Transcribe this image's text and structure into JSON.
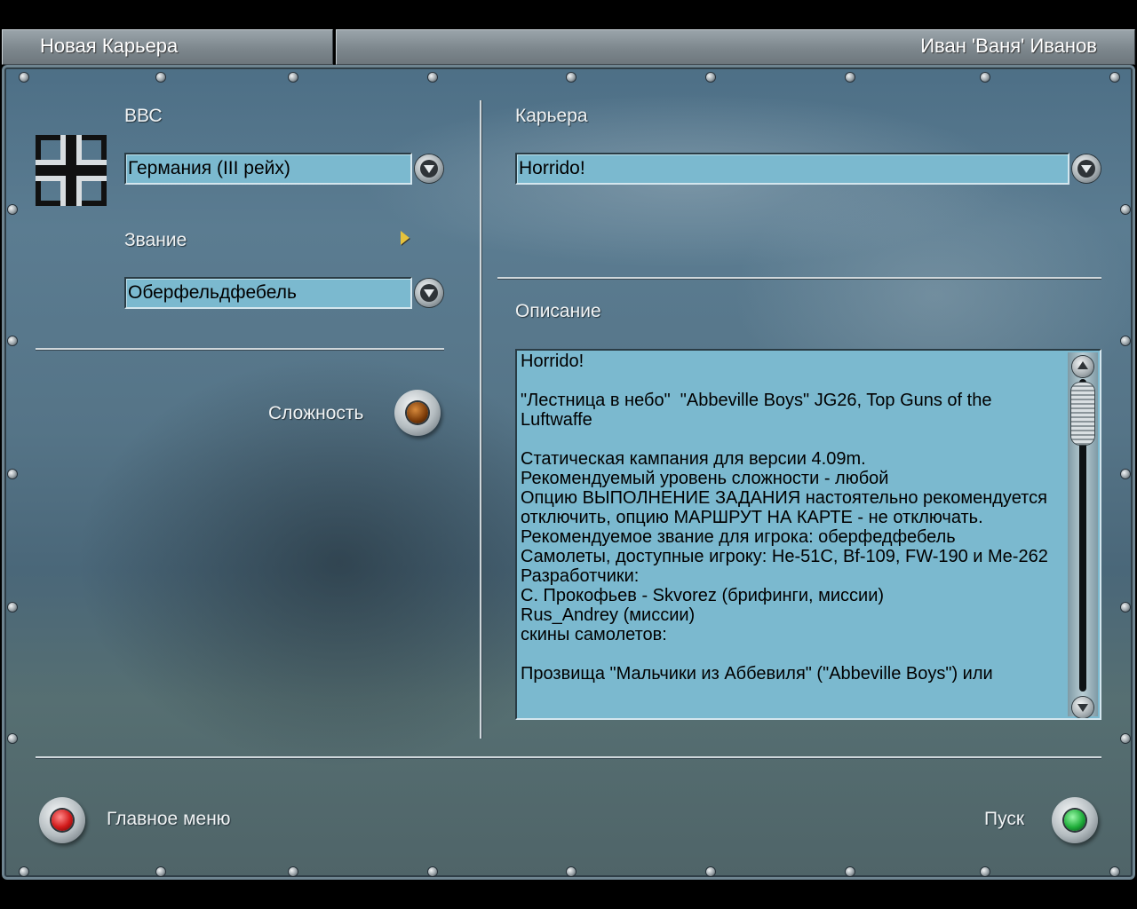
{
  "topbar": {
    "screen_title": "Новая Карьера",
    "pilot_name": "Иван 'Ваня' Иванов"
  },
  "left": {
    "air_force_label": "ВВС",
    "air_force_value": "Германия (III рейх)",
    "air_force_insignia": "balkenkreuz-icon",
    "rank_label": "Звание",
    "rank_value": "Оберфельдфебель",
    "difficulty_label": "Сложность"
  },
  "right": {
    "career_label": "Карьера",
    "career_value": "Horrido!",
    "description_label": "Описание",
    "description_text": "Horrido!\n\n\"Лестница в небо\"  \"Abbeville Boys\" JG26, Top Guns of the Luftwaffe\n\nСтатическая кампания для версии 4.09m.\nРекомендуемый уровень сложности - любой\nОпцию ВЫПОЛНЕНИЕ ЗАДАНИЯ настоятельно рекомендуется отключить, опцию МАРШРУТ НА КАРТЕ - не отключать.\nРекомендуемое звание для игрока: оберфедфебель\nСамолеты, доступные игроку: He-51C, Bf-109, FW-190 и Me-262\nРазработчики:\nС. Прокофьев - Skvorez (брифинги, миссии)\nRus_Andrey (миссии)\nскины самолетов:\n\nПрозвища \"Мальчики из Аббевиля\" (\"Abbeville Boys\") или"
  },
  "bottom": {
    "main_menu_label": "Главное меню",
    "start_label": "Пуск"
  },
  "colors": {
    "field_bg": "#7bb9cf",
    "exit_lamp": "#d11a1a",
    "start_lamp": "#1fae3a",
    "difficulty_lamp": "#7a3a08"
  }
}
